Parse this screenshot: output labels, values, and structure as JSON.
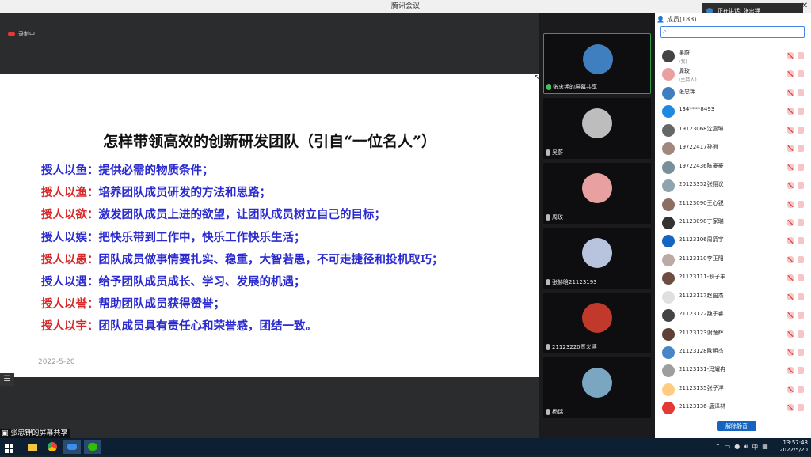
{
  "window": {
    "title": "腾讯会议"
  },
  "recording": {
    "label": "录制中"
  },
  "slide": {
    "title": "怎样带领高效的创新研发团队（引自“一位名人”）",
    "lines": [
      {
        "key": "授人以鱼：",
        "text": "提供必需的物质条件；",
        "red": false
      },
      {
        "key": "授人以渔：",
        "text": "培养团队成员研发的方法和思路；",
        "red": true
      },
      {
        "key": "授人以欲：",
        "text": "激发团队成员上进的欲望，让团队成员树立自己的目标；",
        "red": true
      },
      {
        "key": "授人以娱：",
        "text": "把快乐带到工作中，快乐工作快乐生活；",
        "red": false
      },
      {
        "key": "授人以愚：",
        "text": "团队成员做事情要扎实、稳重，大智若愚，不可走捷径和投机取巧；",
        "red": true
      },
      {
        "key": "授人以遇：",
        "text": "给予团队成员成长、学习、发展的机遇；",
        "red": false
      },
      {
        "key": "授人以誉：",
        "text": "帮助团队成员获得赞誉；",
        "red": true
      },
      {
        "key": "授人以宇：",
        "text": "团队成员具有责任心和荣誉感，团结一致。",
        "red": true
      }
    ],
    "date": "2022-5-20"
  },
  "share_label": "张忠钾的屏幕共享",
  "videos": [
    {
      "name": "张忠钾的屏幕共享",
      "color": "#3f7fbf",
      "active": true
    },
    {
      "name": "吴蔚",
      "color": "#bdbdbd",
      "active": false
    },
    {
      "name": "周玫",
      "color": "#e8a0a0",
      "active": false
    },
    {
      "name": "张赫晗21123193",
      "color": "#b8c4dd",
      "active": false
    },
    {
      "name": "21123220贾义博",
      "color": "#c0392b",
      "active": false
    },
    {
      "name": "杨瑞",
      "color": "#7aa6c2",
      "active": false
    }
  ],
  "members": {
    "header": "成员(183)",
    "search_placeholder": "",
    "unmute_all": "解除静音",
    "list": [
      {
        "name": "吴蔚",
        "sub": "(我)",
        "color": "#444"
      },
      {
        "name": "周玫",
        "sub": "(主持人)",
        "color": "#e8a0a0"
      },
      {
        "name": "张忠钾",
        "sub": "",
        "color": "#3f7fbf"
      },
      {
        "name": "134****8493",
        "sub": "",
        "color": "#1e88e5"
      },
      {
        "name": "19123068沈嘉琳",
        "sub": "",
        "color": "#666"
      },
      {
        "name": "19722417孙逍",
        "sub": "",
        "color": "#a1887f"
      },
      {
        "name": "19722436陈豪豪",
        "sub": "",
        "color": "#78909c"
      },
      {
        "name": "20123352张翔议",
        "sub": "",
        "color": "#90a4ae"
      },
      {
        "name": "21123090王心锐",
        "sub": "",
        "color": "#8d6e63"
      },
      {
        "name": "21123098丁家瑞",
        "sub": "",
        "color": "#333"
      },
      {
        "name": "21123106周箭宇",
        "sub": "",
        "color": "#1565c0"
      },
      {
        "name": "21123110李正阳",
        "sub": "",
        "color": "#bcaaa4"
      },
      {
        "name": "21123111-耿子丰",
        "sub": "",
        "color": "#6d4c41"
      },
      {
        "name": "21123117赵国杰",
        "sub": "",
        "color": "#e0e0e0"
      },
      {
        "name": "21123122魏子睿",
        "sub": "",
        "color": "#444"
      },
      {
        "name": "21123123谢逸辉",
        "sub": "",
        "color": "#5d4037"
      },
      {
        "name": "21123128欧明杰",
        "sub": "",
        "color": "#4a86c5"
      },
      {
        "name": "21123131-冯耀冉",
        "sub": "",
        "color": "#9e9e9e"
      },
      {
        "name": "21123135张子洋",
        "sub": "",
        "color": "#ffcc80"
      },
      {
        "name": "21123136-唐泽林",
        "sub": "",
        "color": "#e53935"
      }
    ]
  },
  "speaking": {
    "label": "正在讲话: 张忠钾"
  },
  "taskbar": {
    "time": "13:57:48",
    "date": "2022/5/20",
    "lang": "中"
  }
}
